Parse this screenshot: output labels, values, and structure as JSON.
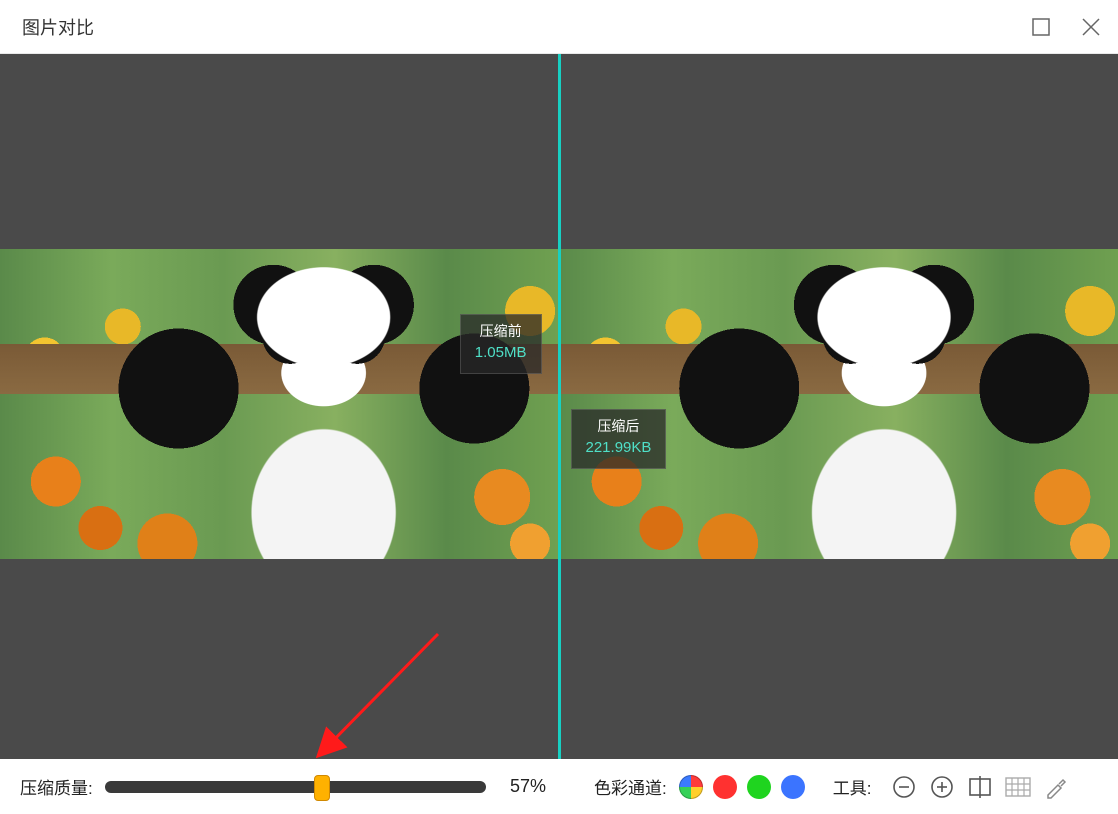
{
  "titlebar": {
    "title": "图片对比"
  },
  "compare": {
    "before": {
      "label": "压缩前",
      "size": "1.05MB"
    },
    "after": {
      "label": "压缩后",
      "size": "221.99KB"
    }
  },
  "quality": {
    "label": "压缩质量:",
    "percent_value": 57,
    "percent_display": "57%"
  },
  "channels": {
    "label": "色彩通道:",
    "items": [
      "rgb",
      "red",
      "green",
      "blue"
    ]
  },
  "tools": {
    "label": "工具:",
    "items": [
      "zoom-out",
      "zoom-in",
      "compare-split",
      "grid",
      "eyedropper"
    ]
  }
}
